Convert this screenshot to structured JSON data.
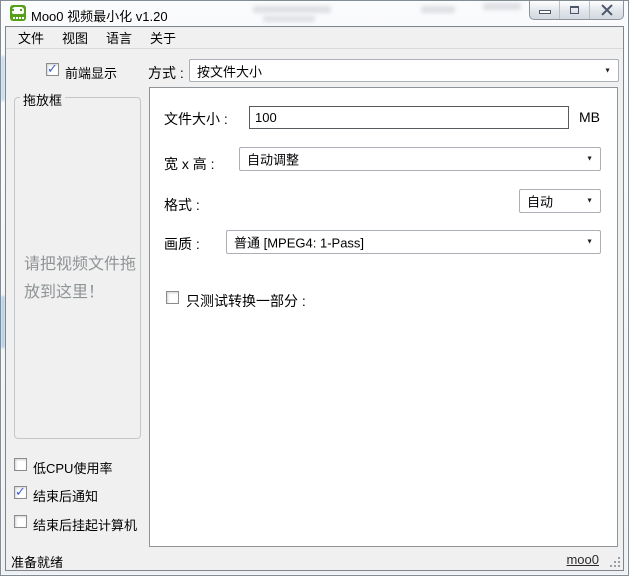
{
  "window": {
    "title": "Moo0 视频最小化 v1.20"
  },
  "menu": {
    "items": [
      {
        "label": "文件"
      },
      {
        "label": "视图"
      },
      {
        "label": "语言"
      },
      {
        "label": "关于"
      }
    ]
  },
  "topbar": {
    "front_display": {
      "label": "前端显示",
      "checked": true
    },
    "method": {
      "label": "方式 :",
      "value": "按文件大小"
    }
  },
  "dropbox": {
    "title": "拖放框",
    "hint_line1": "请把视频文件拖",
    "hint_line2": "放到这里！"
  },
  "settings": {
    "file_size": {
      "label": "文件大小 :",
      "value": "100",
      "unit": "MB"
    },
    "dimensions": {
      "label": "宽 x 高 :",
      "value": "自动调整"
    },
    "format": {
      "label": "格式 :",
      "value": "自动"
    },
    "quality": {
      "label": "画质 :",
      "value": "普通  [MPEG4: 1-Pass]"
    },
    "test_partial": {
      "label": "只测试转换一部分 :",
      "checked": false
    }
  },
  "options": [
    {
      "label": "低CPU使用率",
      "checked": false
    },
    {
      "label": "结束后通知",
      "checked": true
    },
    {
      "label": "结束后挂起计算机",
      "checked": false
    }
  ],
  "statusbar": {
    "status": "准备就绪",
    "link": "moo0"
  },
  "icons": {
    "check": "✓",
    "dropdown_arrow": "▼"
  },
  "colors": {
    "brand_green": "#55a018",
    "check_blue": "#3a5fcd",
    "window_bg": "#f0f0f0"
  }
}
